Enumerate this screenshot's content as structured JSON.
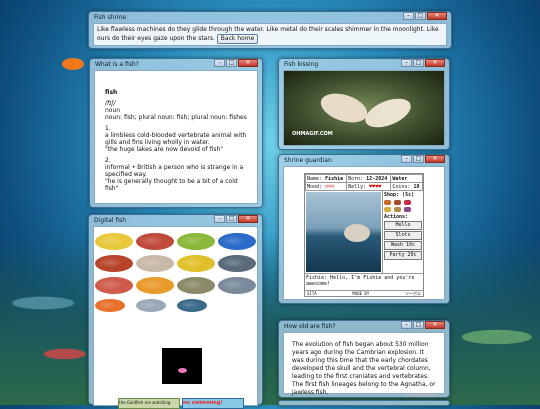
{
  "windows": {
    "fish_shrine": {
      "title": "Fish shrine",
      "text": "Like flawless machines do they glide through the water. Like metal do their scales shimmer in the moonlight. Like ours do their eyes gaze upon the stars.",
      "button": "Back home"
    },
    "what_is_fish": {
      "title": "What is a fish?",
      "word": "fish",
      "ipa": "/fɪʃ/",
      "pos": "noun",
      "plural": "noun: fish; plural noun: fish; plural noun: fishes",
      "def1_num": "1.",
      "def1": "a limbless cold-blooded vertebrate animal with gills and fins living wholly in water.",
      "def1_ex": "\"the huge lakes are now devoid of fish\"",
      "def2_num": "2.",
      "def2": "informal • British a person who is strange in a specified way.",
      "def2_ex": "\"he is generally thought to be a bit of a cold fish\""
    },
    "fish_kissing": {
      "title": "Fish kissing",
      "watermark": "OHMAGIF.COM"
    },
    "shrine_guardian": {
      "title": "Shrine guardian",
      "name_label": "Name:",
      "name_value": "Fishie",
      "born_label": "Born:",
      "born_value": "12-2024",
      "type_value": "Water",
      "mood_label": "Mood:",
      "mood_value": "☺☺☺",
      "belly_label": "Belly:",
      "belly_value": "♥♥♥♥",
      "coins_label": "Coins:",
      "coins_value": "10",
      "shop_label": "Shop: (5c)",
      "actions_label": "Actions:",
      "actions": [
        "Hello",
        "Slots",
        "Wash 10c",
        "Party 20c"
      ],
      "message": "Fishie: Hello, I'm Fishie and you're awesome!",
      "footer_left": "SITA",
      "footer_mid": "MADE BY",
      "footer_right": "ツーポエ"
    },
    "digital_fish": {
      "title": "Digital fish",
      "fish": [
        {
          "icon": "butterflyfish-icon",
          "color": "#e8c83a"
        },
        {
          "icon": "discus-fish-icon",
          "color": "#c04a3a"
        },
        {
          "icon": "green-fish-icon",
          "color": "#8ab83a"
        },
        {
          "icon": "blue-tang-icon",
          "color": "#2a6ac8"
        },
        {
          "icon": "red-fish-icon",
          "color": "#b8442a"
        },
        {
          "icon": "silver-fish-icon",
          "color": "#c8b8a8"
        },
        {
          "icon": "yellow-fish-icon",
          "color": "#e0c02a"
        },
        {
          "icon": "striped-fish-icon",
          "color": "#5a6a7a"
        },
        {
          "icon": "snapper-icon",
          "color": "#d05a4a"
        },
        {
          "icon": "goldfish-icon",
          "color": "#e89a2a"
        },
        {
          "icon": "perch-icon",
          "color": "#8a8a6a"
        },
        {
          "icon": "grey-fish-icon",
          "color": "#7a8a9a"
        },
        {
          "icon": "clownfish-icon",
          "color": "#e8702a"
        },
        {
          "icon": "small-fish-icon",
          "color": "#9aa8b8"
        },
        {
          "icon": "cichlid-icon",
          "color": "#3a6a8a"
        }
      ],
      "badge1": "the Goldfish are watching",
      "badge2": "no swimming!"
    },
    "how_old": {
      "title": "How old are fish?",
      "text": "The evolution of fish began about 530 million years ago during the Cambrian explosion. It was during this time that the early chordates developed the skull and the vertebral column, leading to the first craniates and vertebrates. The first fish lineages belong to the Agnatha, or jawless fish."
    }
  },
  "colors": {
    "window_frame": "#3d6f92",
    "close_button": "#c0392b"
  }
}
